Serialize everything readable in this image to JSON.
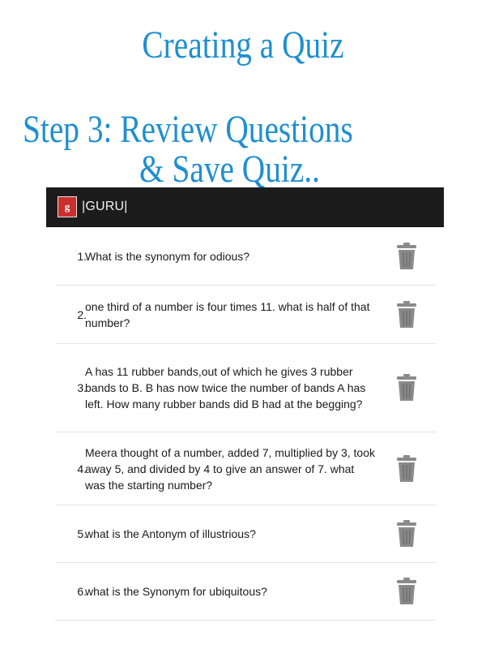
{
  "promo": {
    "title": "Creating a Quiz",
    "step_line1": "Step 3: Review Questions",
    "step_line2": "& Save Quiz.."
  },
  "app": {
    "title": "|GURU|",
    "icon": "guru-app-icon"
  },
  "questions": [
    {
      "number": "1.",
      "text": "What is the synonym for odious?"
    },
    {
      "number": "2.",
      "text": "one third of a number is four times 11. what is half of that number?"
    },
    {
      "number": "3.",
      "text": "A has  11 rubber bands,out of which he gives 3 rubber bands to B. B has now twice the number of bands A has left. How many rubber bands did B had at the begging?"
    },
    {
      "number": "4.",
      "text": "Meera thought of a number, added 7, multiplied by 3, took away 5, and divided by 4 to give an answer of 7. what was the starting number?"
    },
    {
      "number": "5.",
      "text": "what is the Antonym of illustrious?"
    },
    {
      "number": "6.",
      "text": "what is the Synonym for ubiquitous?"
    }
  ],
  "row_icon": "trash-icon"
}
